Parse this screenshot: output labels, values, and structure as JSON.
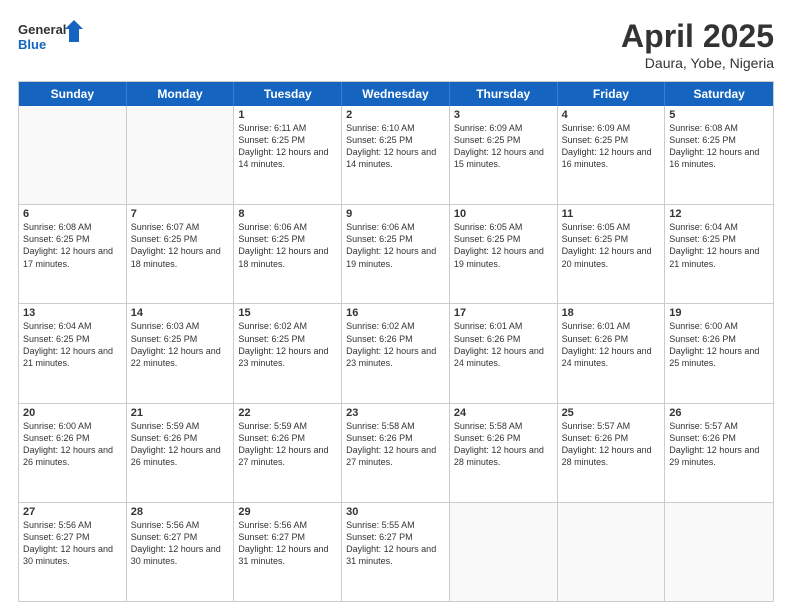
{
  "header": {
    "logo_line1": "General",
    "logo_line2": "Blue",
    "month": "April 2025",
    "location": "Daura, Yobe, Nigeria"
  },
  "days_of_week": [
    "Sunday",
    "Monday",
    "Tuesday",
    "Wednesday",
    "Thursday",
    "Friday",
    "Saturday"
  ],
  "weeks": [
    [
      {
        "day": "",
        "empty": true
      },
      {
        "day": "",
        "empty": true
      },
      {
        "day": "1",
        "info": "Sunrise: 6:11 AM\nSunset: 6:25 PM\nDaylight: 12 hours and 14 minutes."
      },
      {
        "day": "2",
        "info": "Sunrise: 6:10 AM\nSunset: 6:25 PM\nDaylight: 12 hours and 14 minutes."
      },
      {
        "day": "3",
        "info": "Sunrise: 6:09 AM\nSunset: 6:25 PM\nDaylight: 12 hours and 15 minutes."
      },
      {
        "day": "4",
        "info": "Sunrise: 6:09 AM\nSunset: 6:25 PM\nDaylight: 12 hours and 16 minutes."
      },
      {
        "day": "5",
        "info": "Sunrise: 6:08 AM\nSunset: 6:25 PM\nDaylight: 12 hours and 16 minutes."
      }
    ],
    [
      {
        "day": "6",
        "info": "Sunrise: 6:08 AM\nSunset: 6:25 PM\nDaylight: 12 hours and 17 minutes."
      },
      {
        "day": "7",
        "info": "Sunrise: 6:07 AM\nSunset: 6:25 PM\nDaylight: 12 hours and 18 minutes."
      },
      {
        "day": "8",
        "info": "Sunrise: 6:06 AM\nSunset: 6:25 PM\nDaylight: 12 hours and 18 minutes."
      },
      {
        "day": "9",
        "info": "Sunrise: 6:06 AM\nSunset: 6:25 PM\nDaylight: 12 hours and 19 minutes."
      },
      {
        "day": "10",
        "info": "Sunrise: 6:05 AM\nSunset: 6:25 PM\nDaylight: 12 hours and 19 minutes."
      },
      {
        "day": "11",
        "info": "Sunrise: 6:05 AM\nSunset: 6:25 PM\nDaylight: 12 hours and 20 minutes."
      },
      {
        "day": "12",
        "info": "Sunrise: 6:04 AM\nSunset: 6:25 PM\nDaylight: 12 hours and 21 minutes."
      }
    ],
    [
      {
        "day": "13",
        "info": "Sunrise: 6:04 AM\nSunset: 6:25 PM\nDaylight: 12 hours and 21 minutes."
      },
      {
        "day": "14",
        "info": "Sunrise: 6:03 AM\nSunset: 6:25 PM\nDaylight: 12 hours and 22 minutes."
      },
      {
        "day": "15",
        "info": "Sunrise: 6:02 AM\nSunset: 6:25 PM\nDaylight: 12 hours and 23 minutes."
      },
      {
        "day": "16",
        "info": "Sunrise: 6:02 AM\nSunset: 6:26 PM\nDaylight: 12 hours and 23 minutes."
      },
      {
        "day": "17",
        "info": "Sunrise: 6:01 AM\nSunset: 6:26 PM\nDaylight: 12 hours and 24 minutes."
      },
      {
        "day": "18",
        "info": "Sunrise: 6:01 AM\nSunset: 6:26 PM\nDaylight: 12 hours and 24 minutes."
      },
      {
        "day": "19",
        "info": "Sunrise: 6:00 AM\nSunset: 6:26 PM\nDaylight: 12 hours and 25 minutes."
      }
    ],
    [
      {
        "day": "20",
        "info": "Sunrise: 6:00 AM\nSunset: 6:26 PM\nDaylight: 12 hours and 26 minutes."
      },
      {
        "day": "21",
        "info": "Sunrise: 5:59 AM\nSunset: 6:26 PM\nDaylight: 12 hours and 26 minutes."
      },
      {
        "day": "22",
        "info": "Sunrise: 5:59 AM\nSunset: 6:26 PM\nDaylight: 12 hours and 27 minutes."
      },
      {
        "day": "23",
        "info": "Sunrise: 5:58 AM\nSunset: 6:26 PM\nDaylight: 12 hours and 27 minutes."
      },
      {
        "day": "24",
        "info": "Sunrise: 5:58 AM\nSunset: 6:26 PM\nDaylight: 12 hours and 28 minutes."
      },
      {
        "day": "25",
        "info": "Sunrise: 5:57 AM\nSunset: 6:26 PM\nDaylight: 12 hours and 28 minutes."
      },
      {
        "day": "26",
        "info": "Sunrise: 5:57 AM\nSunset: 6:26 PM\nDaylight: 12 hours and 29 minutes."
      }
    ],
    [
      {
        "day": "27",
        "info": "Sunrise: 5:56 AM\nSunset: 6:27 PM\nDaylight: 12 hours and 30 minutes."
      },
      {
        "day": "28",
        "info": "Sunrise: 5:56 AM\nSunset: 6:27 PM\nDaylight: 12 hours and 30 minutes."
      },
      {
        "day": "29",
        "info": "Sunrise: 5:56 AM\nSunset: 6:27 PM\nDaylight: 12 hours and 31 minutes."
      },
      {
        "day": "30",
        "info": "Sunrise: 5:55 AM\nSunset: 6:27 PM\nDaylight: 12 hours and 31 minutes."
      },
      {
        "day": "",
        "empty": true
      },
      {
        "day": "",
        "empty": true
      },
      {
        "day": "",
        "empty": true
      }
    ]
  ]
}
